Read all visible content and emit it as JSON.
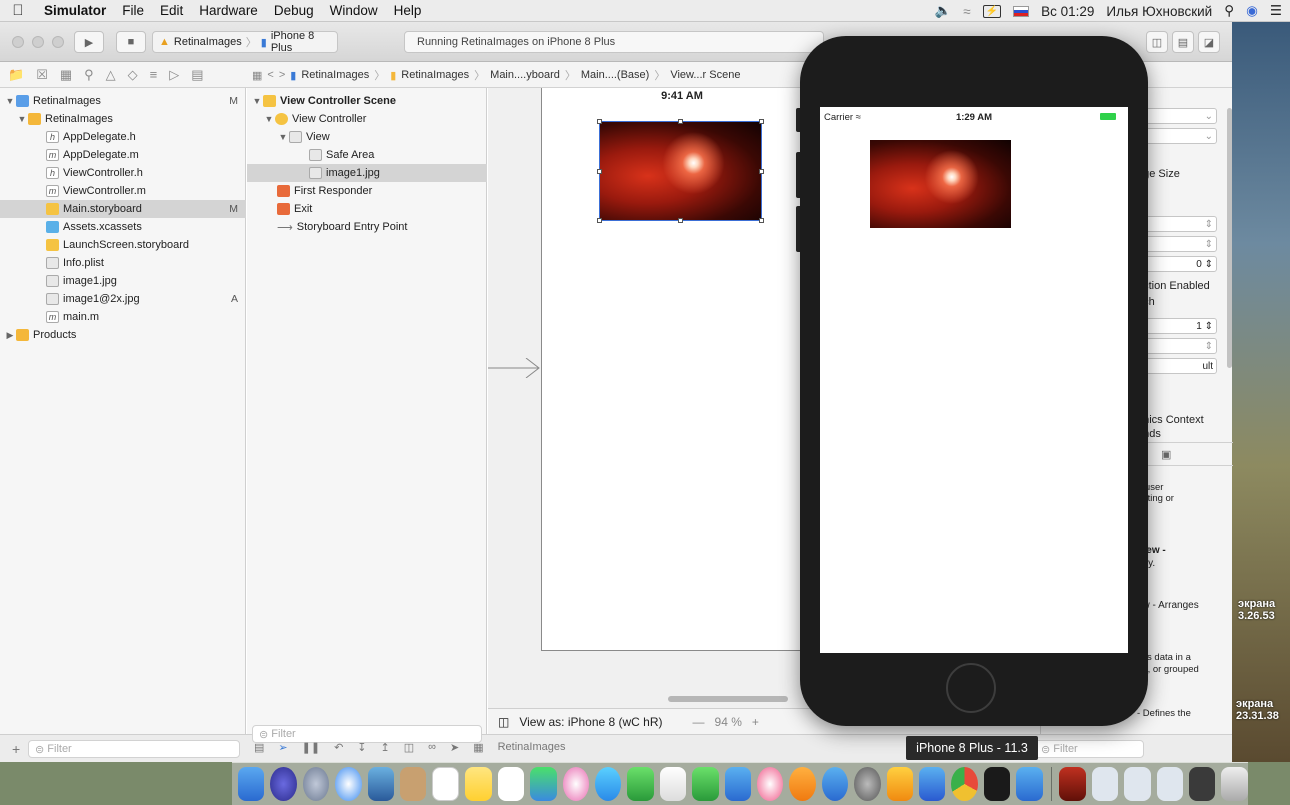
{
  "menubar": {
    "app": "Simulator",
    "items": [
      "File",
      "Edit",
      "Hardware",
      "Debug",
      "Window",
      "Help"
    ],
    "clock": "Вс 01:29",
    "user": "Илья Юхновский"
  },
  "toolbar": {
    "scheme_target": "RetinaImages",
    "scheme_device": "iPhone 8 Plus",
    "activity": "Running RetinaImages on iPhone 8 Plus"
  },
  "jumpbar": [
    "RetinaImages",
    "RetinaImages",
    "Main....yboard",
    "Main....(Base)",
    "View...r Scene"
  ],
  "navigator": {
    "items": [
      {
        "label": "RetinaImages",
        "badge": "M",
        "level": 0,
        "icon": "project-icon"
      },
      {
        "label": "RetinaImages",
        "badge": "",
        "level": 1,
        "icon": "folder-icon"
      },
      {
        "label": "AppDelegate.h",
        "badge": "",
        "level": 2,
        "icon": "header-file-icon"
      },
      {
        "label": "AppDelegate.m",
        "badge": "",
        "level": 2,
        "icon": "source-file-icon"
      },
      {
        "label": "ViewController.h",
        "badge": "",
        "level": 2,
        "icon": "header-file-icon"
      },
      {
        "label": "ViewController.m",
        "badge": "",
        "level": 2,
        "icon": "source-file-icon"
      },
      {
        "label": "Main.storyboard",
        "badge": "M",
        "level": 2,
        "icon": "storyboard-icon"
      },
      {
        "label": "Assets.xcassets",
        "badge": "",
        "level": 2,
        "icon": "asset-catalog-icon"
      },
      {
        "label": "LaunchScreen.storyboard",
        "badge": "",
        "level": 2,
        "icon": "storyboard-icon"
      },
      {
        "label": "Info.plist",
        "badge": "",
        "level": 2,
        "icon": "plist-icon"
      },
      {
        "label": "image1.jpg",
        "badge": "",
        "level": 2,
        "icon": "image-file-icon"
      },
      {
        "label": "image1@2x.jpg",
        "badge": "A",
        "level": 2,
        "icon": "image-file-icon"
      },
      {
        "label": "main.m",
        "badge": "",
        "level": 2,
        "icon": "source-file-icon"
      },
      {
        "label": "Products",
        "badge": "",
        "level": 1,
        "icon": "folder-icon"
      }
    ],
    "filter_placeholder": "Filter"
  },
  "outline": {
    "items": [
      {
        "label": "View Controller Scene",
        "level": 0
      },
      {
        "label": "View Controller",
        "level": 1
      },
      {
        "label": "View",
        "level": 2
      },
      {
        "label": "Safe Area",
        "level": 3
      },
      {
        "label": "image1.jpg",
        "level": 3
      },
      {
        "label": "First Responder",
        "level": 1
      },
      {
        "label": "Exit",
        "level": 1
      },
      {
        "label": "Storyboard Entry Point",
        "level": 1
      }
    ],
    "filter_placeholder": "Filter"
  },
  "canvas": {
    "scene_time": "9:41 AM",
    "view_as": "View as: iPhone 8 (wC hR)",
    "zoom": "94 %",
    "minus": "—",
    "plus": "+"
  },
  "inspector": {
    "labels": [
      "age Size",
      "action Enabled",
      "uch",
      "ult",
      "phics Context",
      "unds"
    ],
    "values": [
      "0",
      "1"
    ],
    "library": [
      "a user",
      "enting or",
      "e.",
      "View -",
      "arly.",
      "ew - Arranges",
      "ays data in a",
      "ed, or grouped",
      "- Defines the"
    ]
  },
  "bottombar": {
    "filter_placeholder": "Filter",
    "debug_target": "RetinaImages",
    "library_filter": "Filter"
  },
  "simulator": {
    "carrier": "Carrier",
    "time": "1:29 AM",
    "tooltip": "iPhone 8 Plus - 11.3"
  },
  "desktop": {
    "label1a": "экрана",
    "label1b": "3.26.53",
    "label2a": "экрана",
    "label2b": "23.31.38"
  }
}
